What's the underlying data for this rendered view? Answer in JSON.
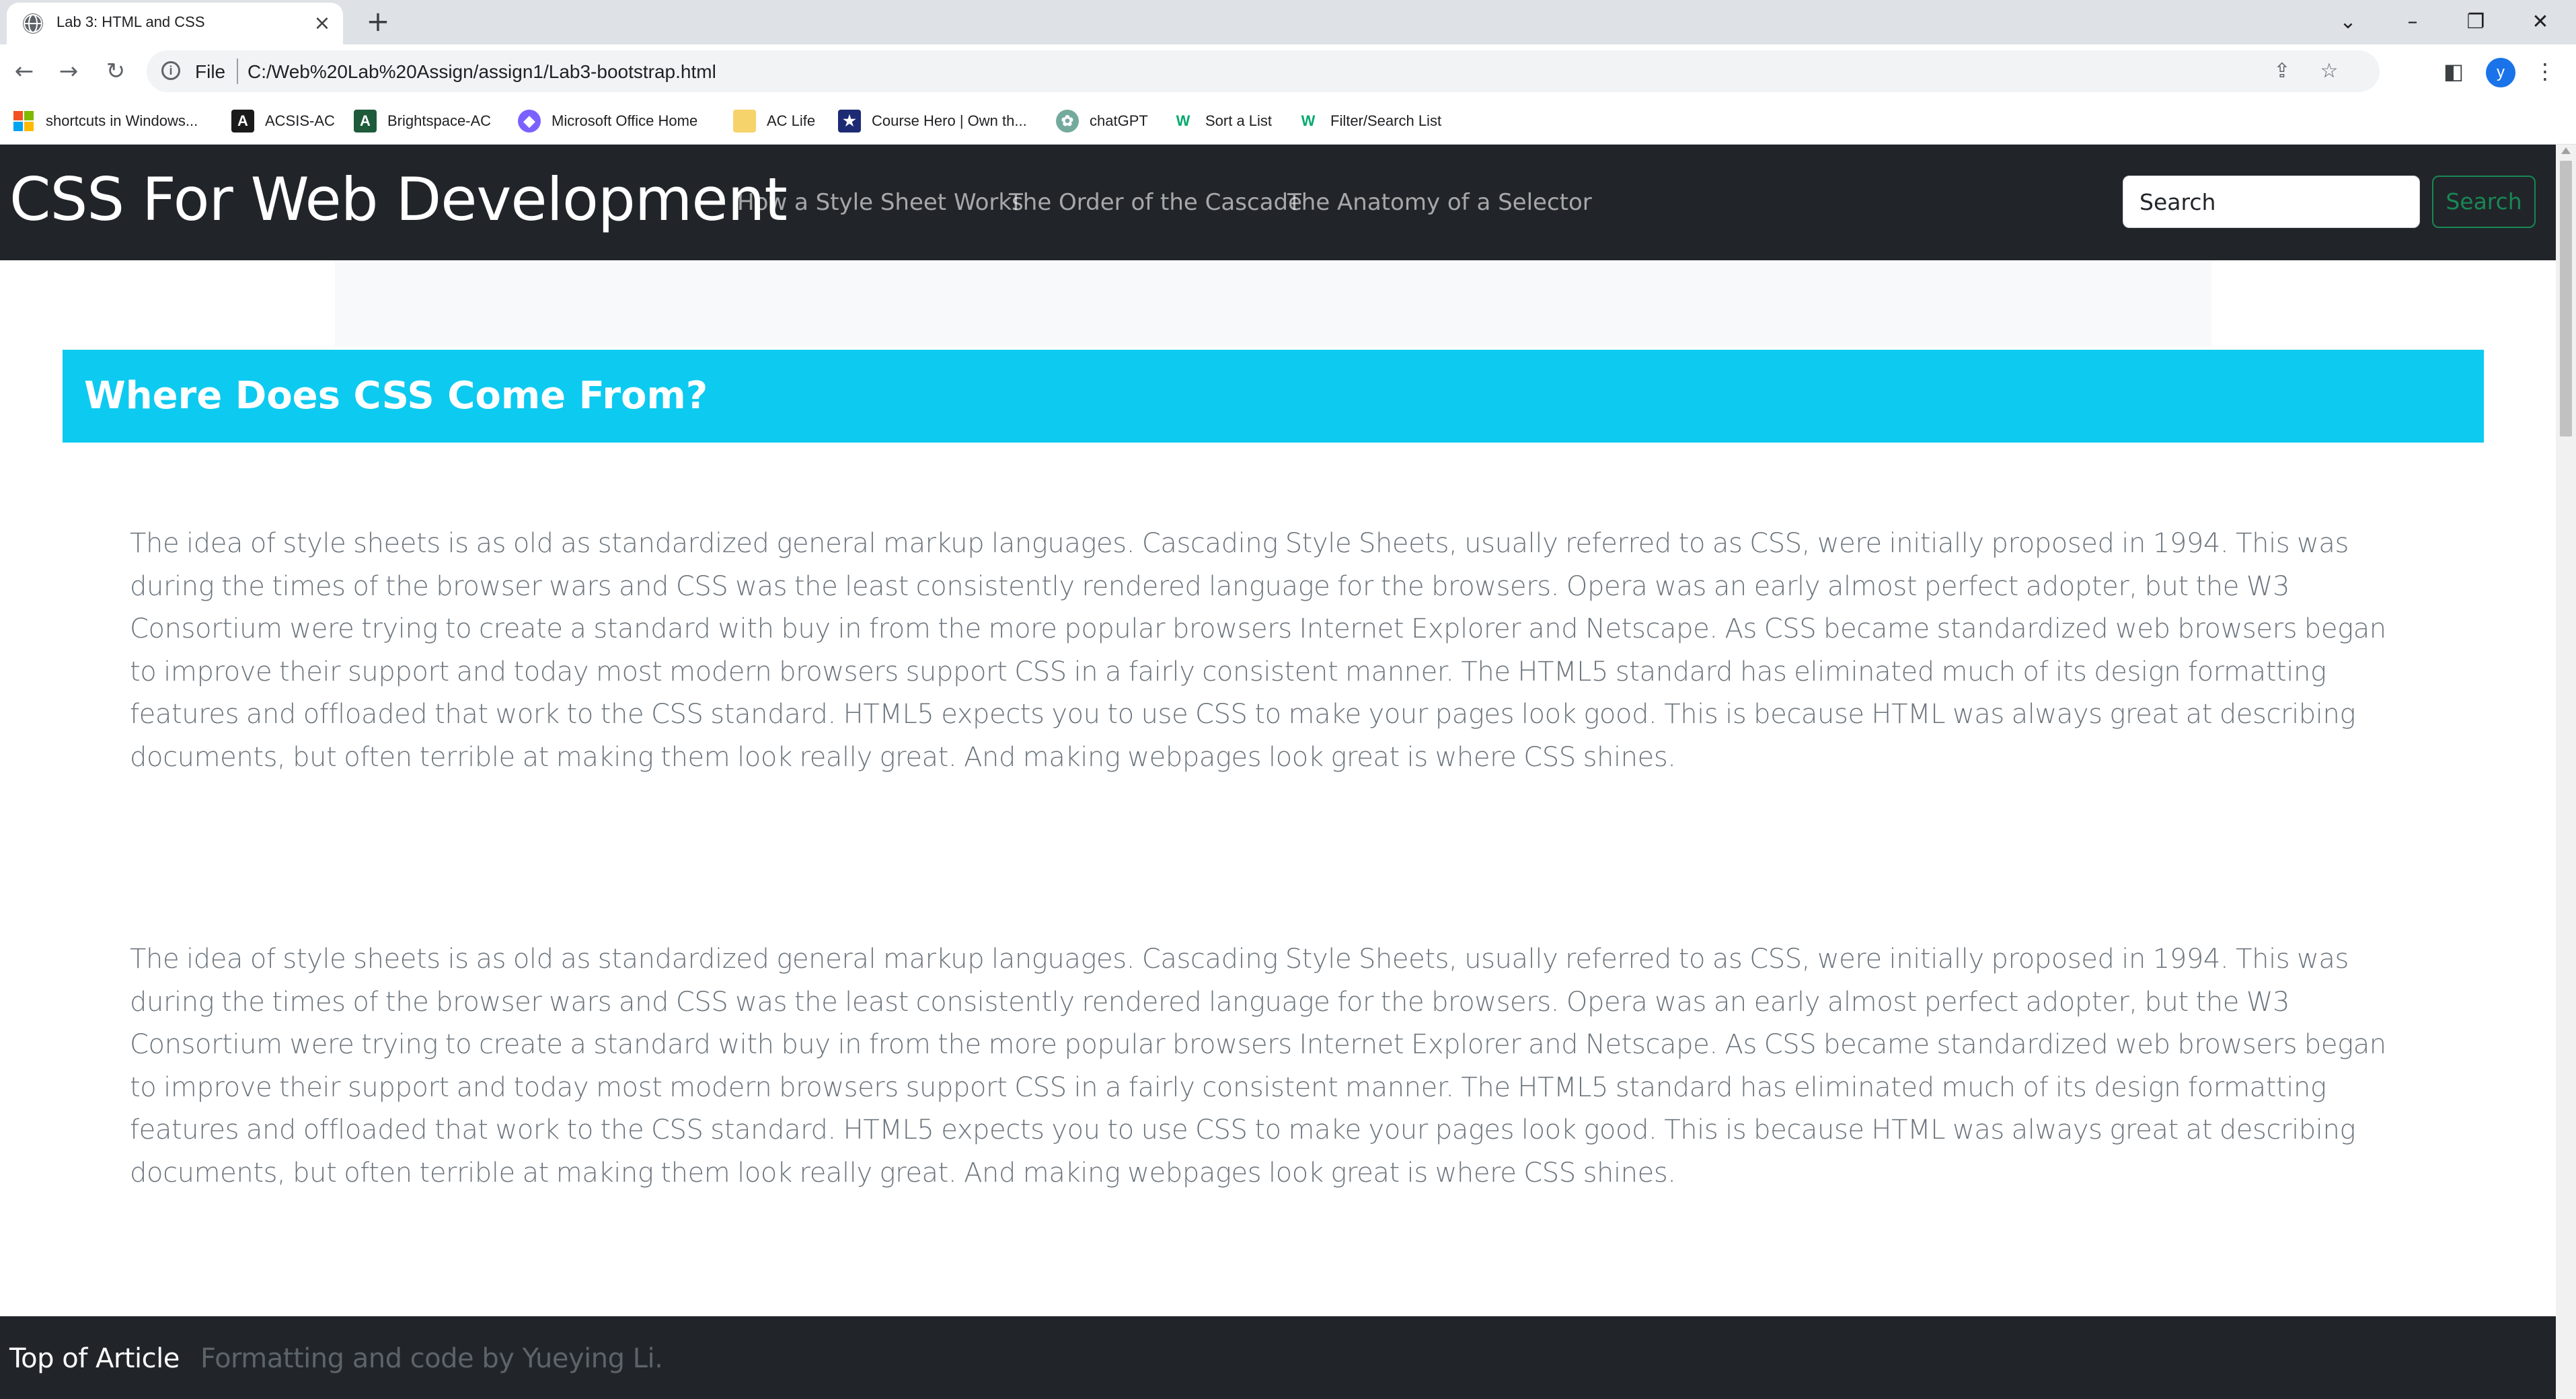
{
  "browser": {
    "tab_title": "Lab 3: HTML and CSS",
    "tab_close": "×",
    "new_tab": "+",
    "window_controls": {
      "dropdown": "⌄",
      "minimize": "–",
      "restore": "❐",
      "close": "✕"
    },
    "nav": {
      "back": "←",
      "forward": "→",
      "reload": "↻"
    },
    "url_scheme": "File",
    "url": "C:/Web%20Lab%20Assign/assign1/Lab3-bootstrap.html",
    "profile_initial": "y",
    "bookmarks": [
      {
        "label": "shortcuts in Windows...",
        "icon": "windows-logo-icon",
        "color": "#00a4ef"
      },
      {
        "label": "ACSIS-AC",
        "icon": "acsis-icon",
        "color": "#1b1b1b"
      },
      {
        "label": "Brightspace-AC",
        "icon": "brightspace-icon",
        "color": "#1e5b3a"
      },
      {
        "label": "Microsoft Office Home",
        "icon": "office-icon",
        "color": "#7b61ff"
      },
      {
        "label": "AC Life",
        "icon": "folder-icon",
        "color": "#f6d36b"
      },
      {
        "label": "Course Hero | Own th...",
        "icon": "coursehero-icon",
        "color": "#1d2b74"
      },
      {
        "label": "chatGPT",
        "icon": "chatgpt-icon",
        "color": "#74aa9c"
      },
      {
        "label": "Sort a List",
        "icon": "w3-icon",
        "color": "#04aa6d"
      },
      {
        "label": "Filter/Search List",
        "icon": "w3-icon",
        "color": "#04aa6d"
      }
    ]
  },
  "site": {
    "brand": "CSS For Web Development",
    "nav_links": [
      "How a Style Sheet Works",
      "The Order of the Cascade",
      "The Anatomy of a Selector"
    ],
    "search": {
      "placeholder": "Search",
      "button": "Search"
    },
    "colors": {
      "navbar": "#212529",
      "header": "#0dcaf0",
      "success": "#198754",
      "muted_text": "#6c757d"
    }
  },
  "main": {
    "section_title": "Where Does CSS Come From?",
    "paragraphs": [
      "The idea of style sheets is as old as standardized general markup languages. Cascading Style Sheets, usually referred to as CSS, were initially proposed in 1994. This was during the times of the browser wars and CSS was the least consistently rendered language for the browsers. Opera was an early almost perfect adopter, but the W3 Consortium were trying to create a standard with buy in from the more popular browsers Internet Explorer and Netscape. As CSS became standardized web browsers began to improve their support and today most modern browsers support CSS in a fairly consistent manner. The HTML5 standard has eliminated much of its design formatting features and offloaded that work to the CSS standard. HTML5 expects you to use CSS to make your pages look good. This is because HTML was always great at describing documents, but often terrible at making them look really great. And making webpages look great is where CSS shines.",
      "The idea of style sheets is as old as standardized general markup languages. Cascading Style Sheets, usually referred to as CSS, were initially proposed in 1994. This was during the times of the browser wars and CSS was the least consistently rendered language for the browsers. Opera was an early almost perfect adopter, but the W3 Consortium were trying to create a standard with buy in from the more popular browsers Internet Explorer and Netscape. As CSS became standardized web browsers began to improve their support and today most modern browsers support CSS in a fairly consistent manner. The HTML5 standard has eliminated much of its design formatting features and offloaded that work to the CSS standard. HTML5 expects you to use CSS to make your pages look good. This is because HTML was always great at describing documents, but often terrible at making them look really great. And making webpages look great is where CSS shines."
    ]
  },
  "footer": {
    "top_link": "Top of Article",
    "credit": "Formatting and code by Yueying Li."
  }
}
